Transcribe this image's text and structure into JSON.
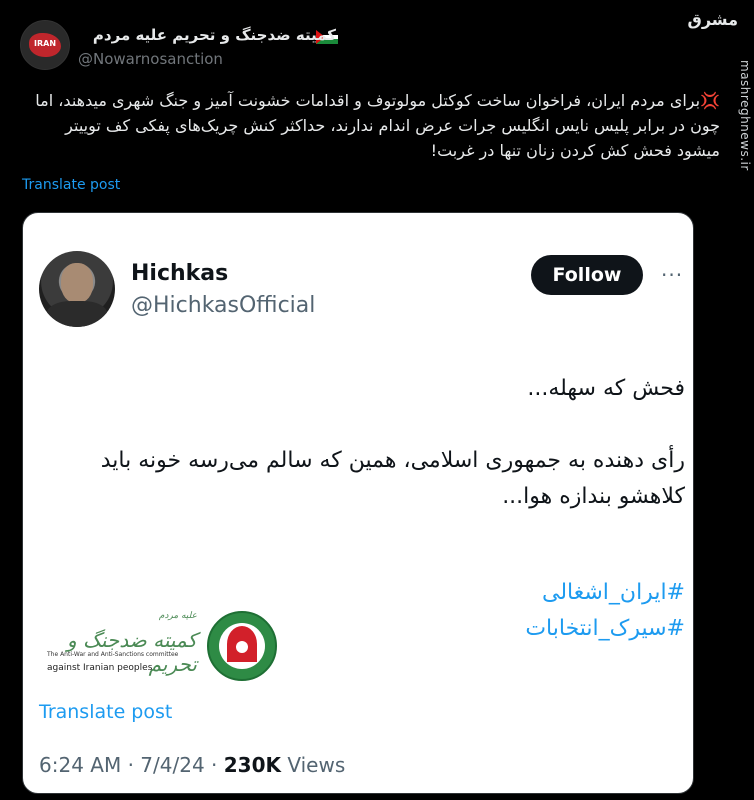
{
  "header": {
    "display_name": "کمیته ضدجنگ و تحریم علیه مردم",
    "handle": "@Nowarnosanction",
    "avatar_label": "IRAN"
  },
  "watermark": {
    "logo_text": "مشرق",
    "site": "mashreghnews.ir"
  },
  "post": {
    "emoji": "💢",
    "text": "برای مردم ایران، فراخوان ساخت کوکتل مولوتوف و اقدامات خشونت آمیز و جنگ شهری میدهند، اما چون در برابر پلیس نایس انگلیس جرات عرض اندام ندارند، حداکثر کنش چریک‌های پفکی کف توییتر میشود فحش کش کردن زنان تنها در غربت!",
    "translate": "Translate post"
  },
  "quoted": {
    "name": "Hichkas",
    "handle": "@HichkasOfficial",
    "follow_label": "Follow",
    "more": "···",
    "line1": "فحش که سهله...",
    "line2": "رأی دهنده به جمهوری اسلامی، همین که سالم می‌رسه خونه باید کلاهشو بندازه هوا...",
    "hashtags": [
      "#ایران_اشغالی",
      "#سیرک_انتخابات"
    ],
    "translate": "Translate post",
    "time": "6:24 AM",
    "date": "7/4/24",
    "views_count": "230K",
    "views_label": "Views",
    "sep": "·"
  },
  "logo": {
    "script": "کمیته ضدجنگ و تحریم",
    "script_small": "علیه مردم",
    "sub_line": "The Anti-War and Anti-Sanctions committee",
    "sub_line2": "against Iranian peoples"
  }
}
